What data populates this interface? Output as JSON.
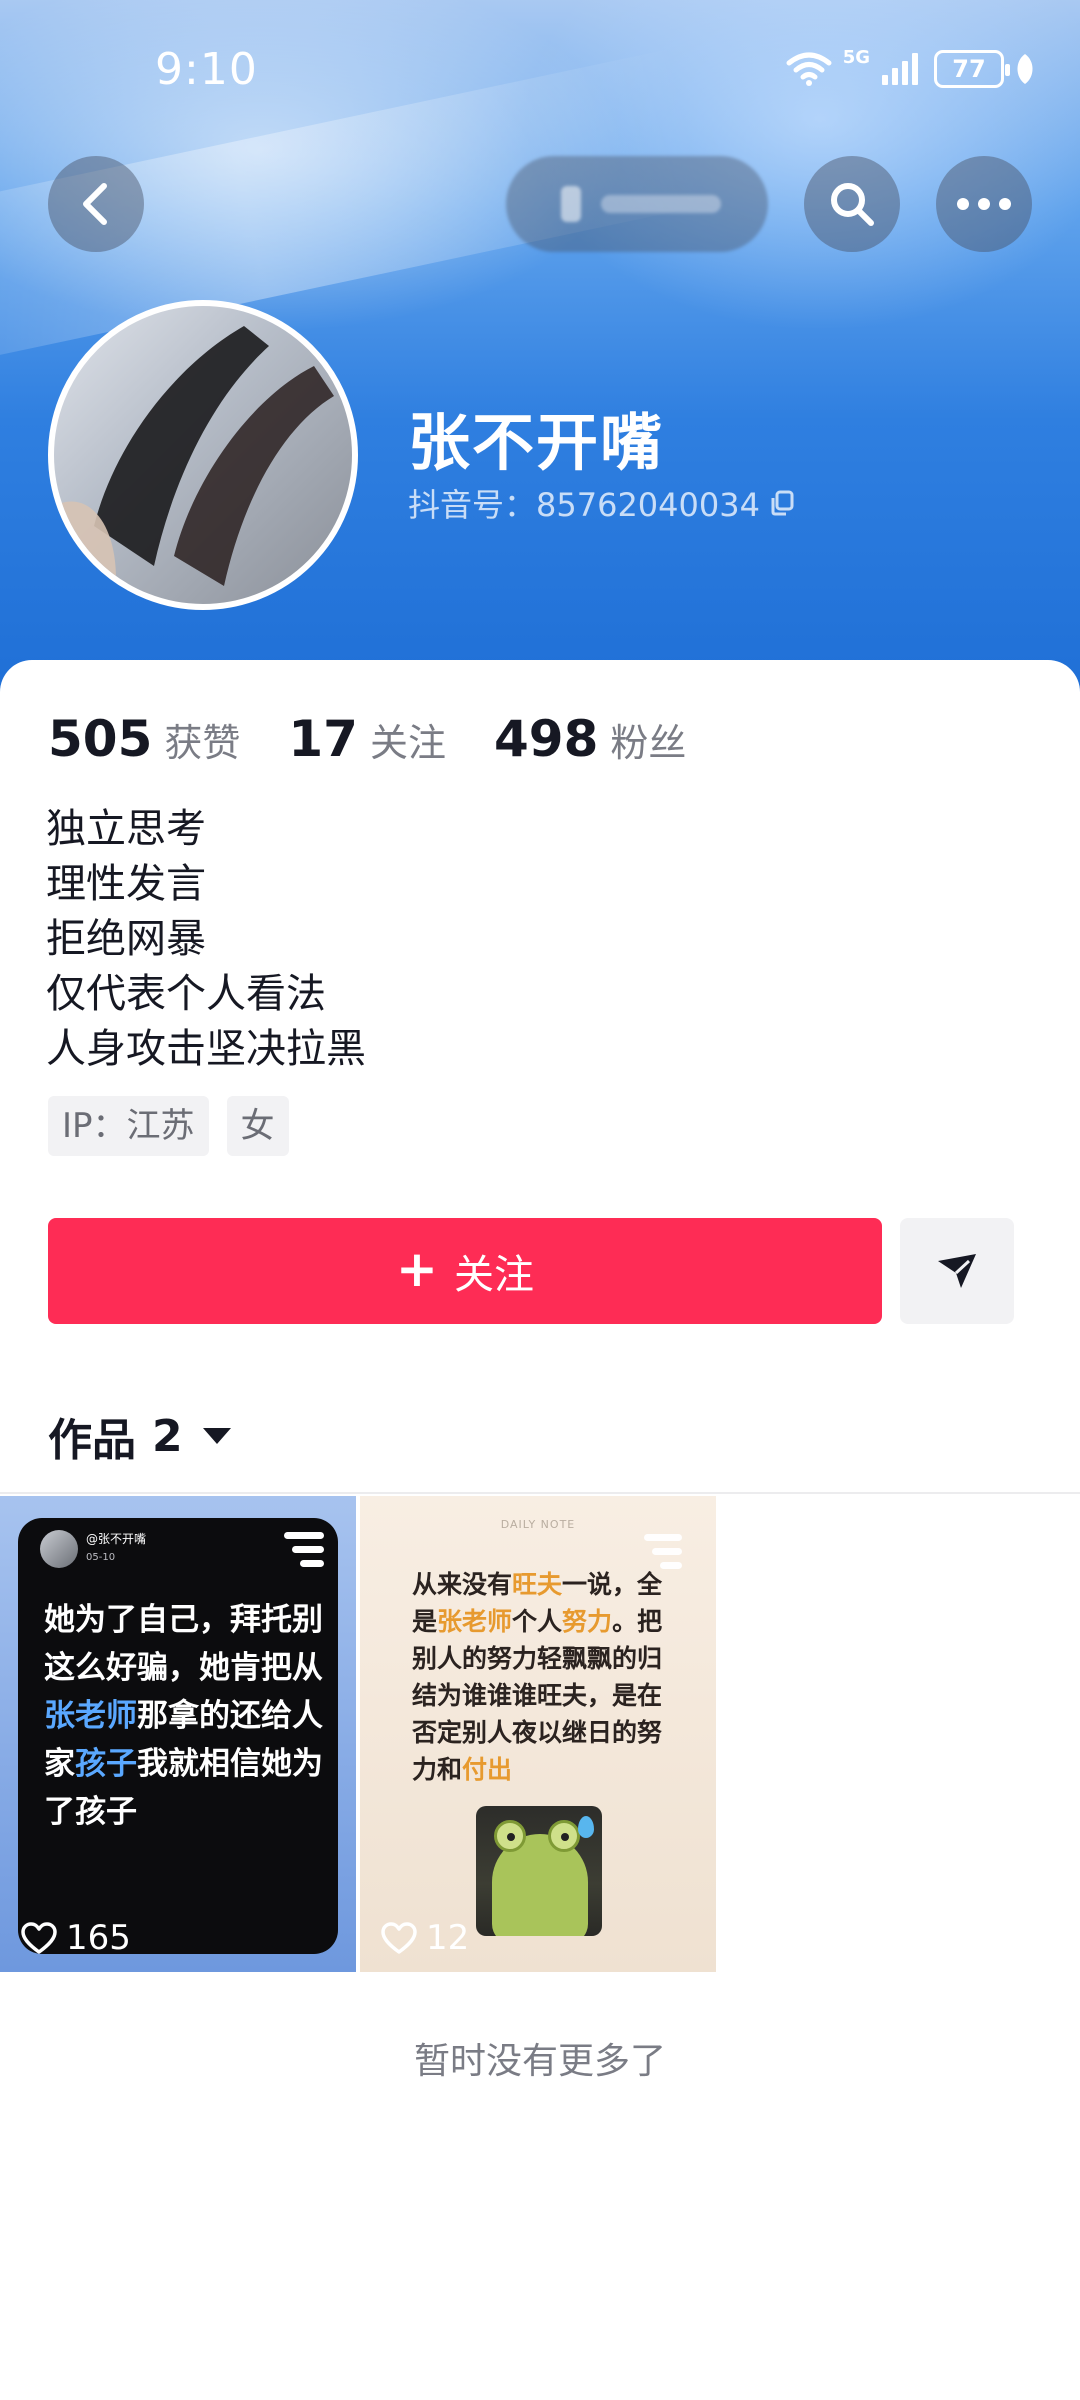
{
  "status_bar": {
    "time": "9:10",
    "network": "5G",
    "battery": "77"
  },
  "header": {
    "icons": {
      "back": "back-arrow-icon",
      "search": "search-icon",
      "more": "more-dots-icon"
    }
  },
  "profile": {
    "name": "张不开嘴",
    "douyin_id": "抖音号：85762040034",
    "stats": [
      {
        "value": "505",
        "label": "获赞"
      },
      {
        "value": "17",
        "label": "关注"
      },
      {
        "value": "498",
        "label": "粉丝"
      }
    ],
    "bio": [
      "独立思考",
      "理性发言",
      "拒绝网暴",
      "仅代表个人看法",
      "人身攻击坚决拉黑"
    ],
    "tags": [
      "IP：江苏",
      "女"
    ]
  },
  "actions": {
    "follow_plus": "+",
    "follow_label": "关注"
  },
  "works": {
    "title": "作品",
    "count": "2",
    "items": [
      {
        "user": "@张不开嘴",
        "date": "05-10",
        "text_parts": [
          "她为了自己，拜托别这么好骗，她肯把从",
          "张老师",
          "那拿的还给人家",
          "孩子",
          "我就相信她为了孩子"
        ],
        "likes": "165"
      },
      {
        "header": "DAILY NOTE",
        "text_parts": [
          "从来没有",
          "旺夫",
          "一说，全是",
          "张老师",
          "个人",
          "努力",
          "。把别人的努力轻飘飘的归结为谁谁谁旺夫，是在否定别人夜以继日的努力和",
          "付出"
        ],
        "likes": "12"
      }
    ],
    "end_text": "暂时没有更多了"
  },
  "colors": {
    "accent": "#fe2c55",
    "highlight_blue": "#5aa8ff",
    "highlight_orange": "#e79a2f"
  }
}
